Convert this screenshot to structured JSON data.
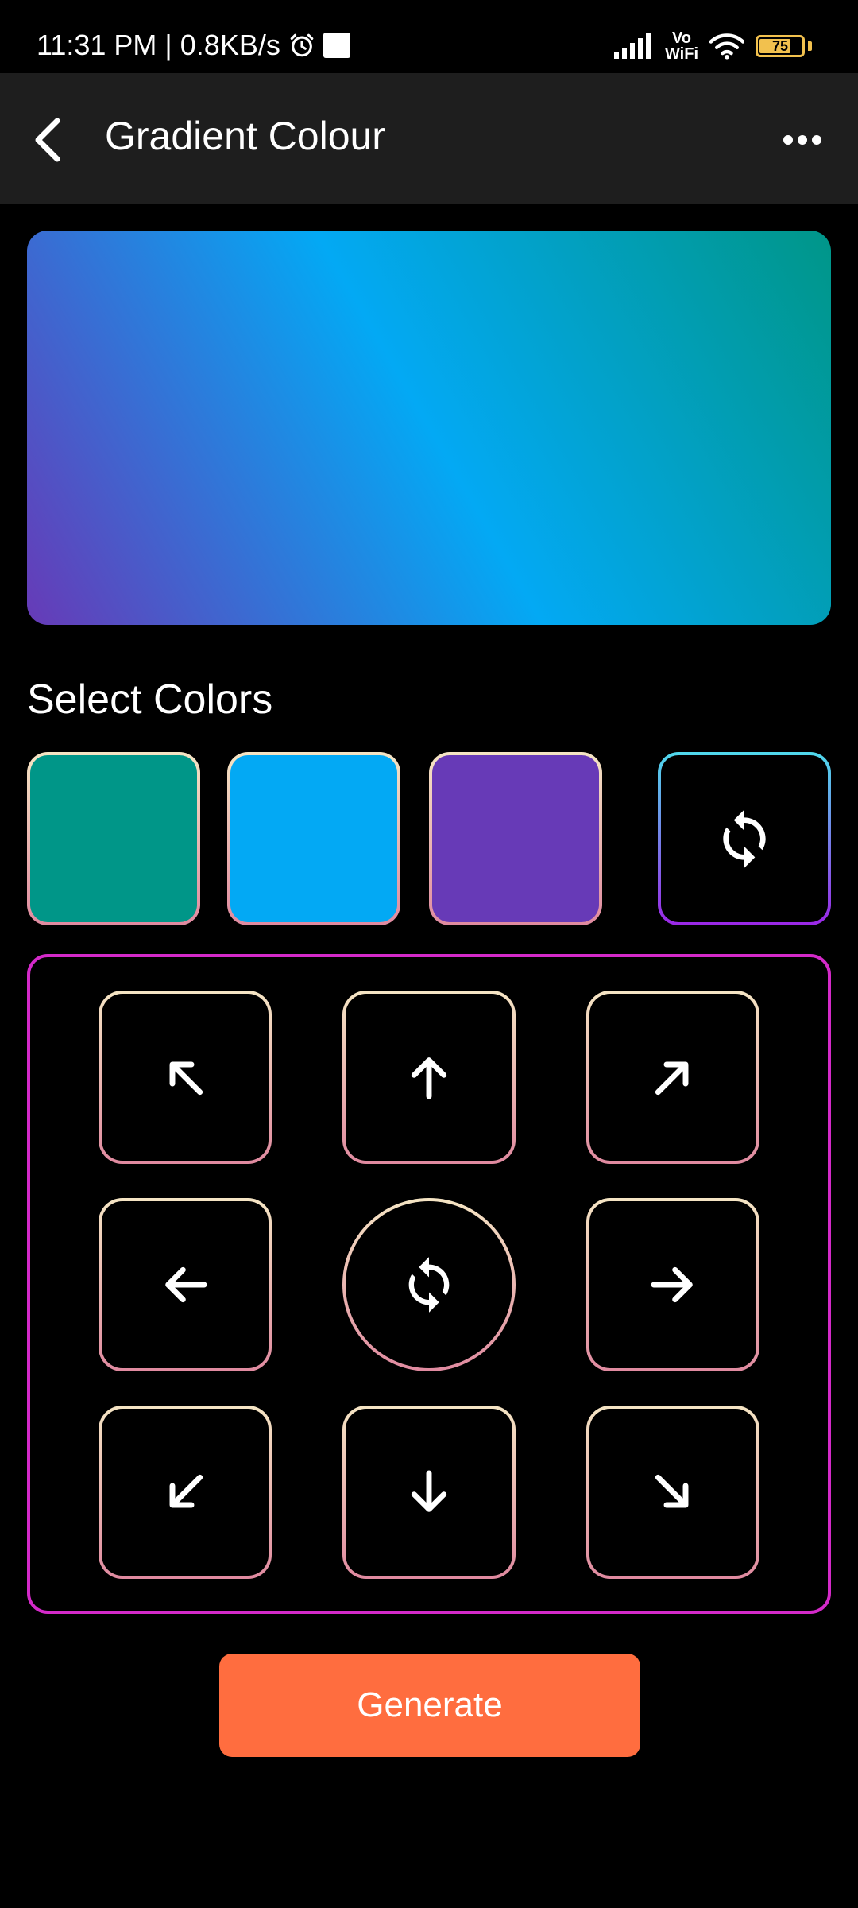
{
  "status_bar": {
    "time_speed": "11:31 PM | 0.8KB/s",
    "vowifi_top": "Vo",
    "vowifi_bottom": "WiFi",
    "battery_level": "75",
    "battery_fraction": 0.75
  },
  "app_bar": {
    "title": "Gradient Colour",
    "back_icon": "back-arrow-icon",
    "menu_icon": "more-horizontal-icon"
  },
  "preview": {
    "colors": [
      "#673ab7",
      "#03a9f4",
      "#009688"
    ]
  },
  "select_colors": {
    "title": "Select Colors",
    "swatches": [
      "#009688",
      "#03a9f4",
      "#673ab7"
    ],
    "shuffle_icon": "shuffle-icon"
  },
  "directions": [
    "top-left",
    "top",
    "top-right",
    "left",
    "center",
    "right",
    "bottom-left",
    "bottom",
    "bottom-right"
  ],
  "generate_label": "Generate",
  "colors": {
    "accent": "#ff6d3f",
    "panel_border": "#d42ac9",
    "app_bar_bg": "#1e1e1e"
  }
}
